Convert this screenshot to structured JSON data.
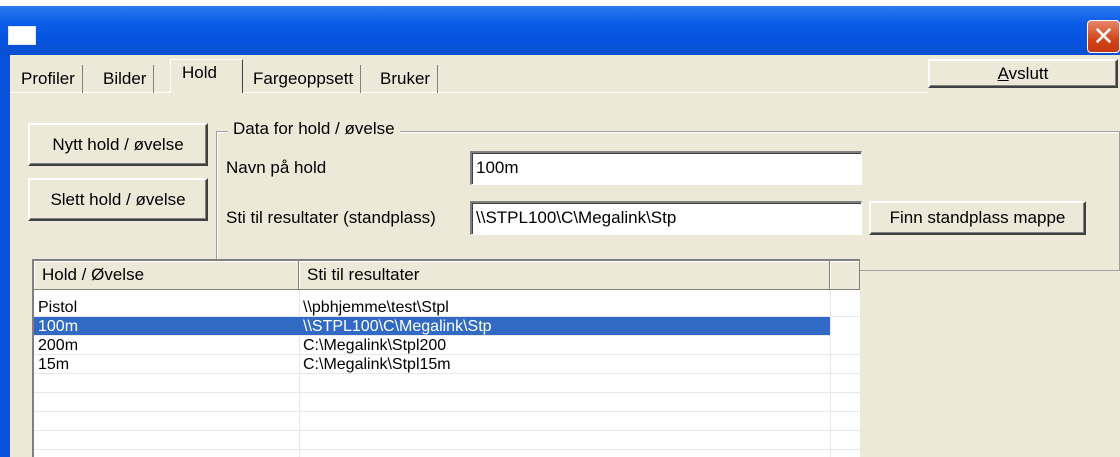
{
  "window": {
    "title": "",
    "close_glyph": "✕",
    "colors": {
      "titlebar": "#0553de",
      "close": "#d24417",
      "client": "#ece9d8",
      "selection": "#316ac5"
    }
  },
  "tabs": [
    {
      "label": "Profiler",
      "active": false
    },
    {
      "label": "Bilder",
      "active": false
    },
    {
      "label": "Hold",
      "active": true
    },
    {
      "label": "Fargeoppsett",
      "active": false
    },
    {
      "label": "Bruker",
      "active": false
    }
  ],
  "exit_button": {
    "label": "Avslutt",
    "mnemonic": "A"
  },
  "actions": {
    "new_label": "Nytt hold / øvelse",
    "delete_label": "Slett hold / øvelse"
  },
  "group": {
    "legend": "Data for hold / øvelse",
    "name_label": "Navn på hold",
    "name_value": "100m",
    "path_label": "Sti til resultater (standplass)",
    "path_value": "\\\\STPL100\\C\\Megalink\\Stp",
    "browse_label": "Finn standplass mappe"
  },
  "list": {
    "columns": [
      "Hold / Øvelse",
      "Sti til resultater"
    ],
    "selected_index": 1,
    "rows": [
      {
        "name": "Pistol",
        "path": "\\\\pbhjemme\\test\\Stpl"
      },
      {
        "name": "100m",
        "path": "\\\\STPL100\\C\\Megalink\\Stp"
      },
      {
        "name": "200m",
        "path": "C:\\Megalink\\Stpl200"
      },
      {
        "name": "15m",
        "path": "C:\\Megalink\\Stpl15m"
      }
    ]
  }
}
